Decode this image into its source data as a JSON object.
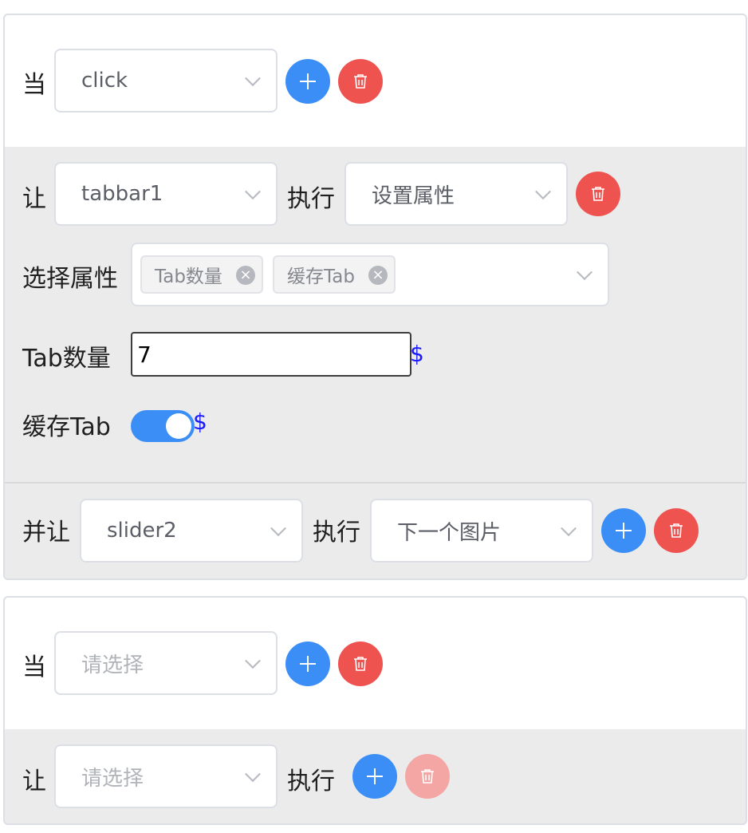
{
  "rules": [
    {
      "when_label": "当",
      "event_select": {
        "value": "click",
        "placeholder": "请选择"
      },
      "let_label": "让",
      "target_select": {
        "value": "tabbar1",
        "placeholder": "请选择"
      },
      "exec_label": "执行",
      "action_select": {
        "value": "设置属性",
        "placeholder": "请选择"
      },
      "choose_attr_label": "选择属性",
      "attr_tags": [
        "Tab数量",
        "缓存Tab"
      ],
      "tab_count": {
        "label": "Tab数量",
        "value": "7",
        "binding_symbol": "$"
      },
      "cache_tab": {
        "label": "缓存Tab",
        "on": true,
        "binding_symbol": "$"
      },
      "also_let_label": "并让",
      "second_target_select": {
        "value": "slider2",
        "placeholder": "请选择"
      },
      "second_exec_label": "执行",
      "second_action_select": {
        "value": "下一个图片",
        "placeholder": "请选择"
      }
    },
    {
      "when_label": "当",
      "event_select": {
        "value": "",
        "placeholder": "请选择"
      },
      "let_label": "让",
      "target_select": {
        "value": "",
        "placeholder": "请选择"
      },
      "exec_label": "执行"
    }
  ],
  "icons": {
    "add": "plus-icon",
    "delete": "trash-icon",
    "dropdown": "chevron-down-icon",
    "remove_tag": "close-circle-icon"
  },
  "colors": {
    "primary": "#3a8ef6",
    "danger": "#ef5350",
    "danger_disabled": "#f4a6a4",
    "binding": "#1a1aff"
  }
}
